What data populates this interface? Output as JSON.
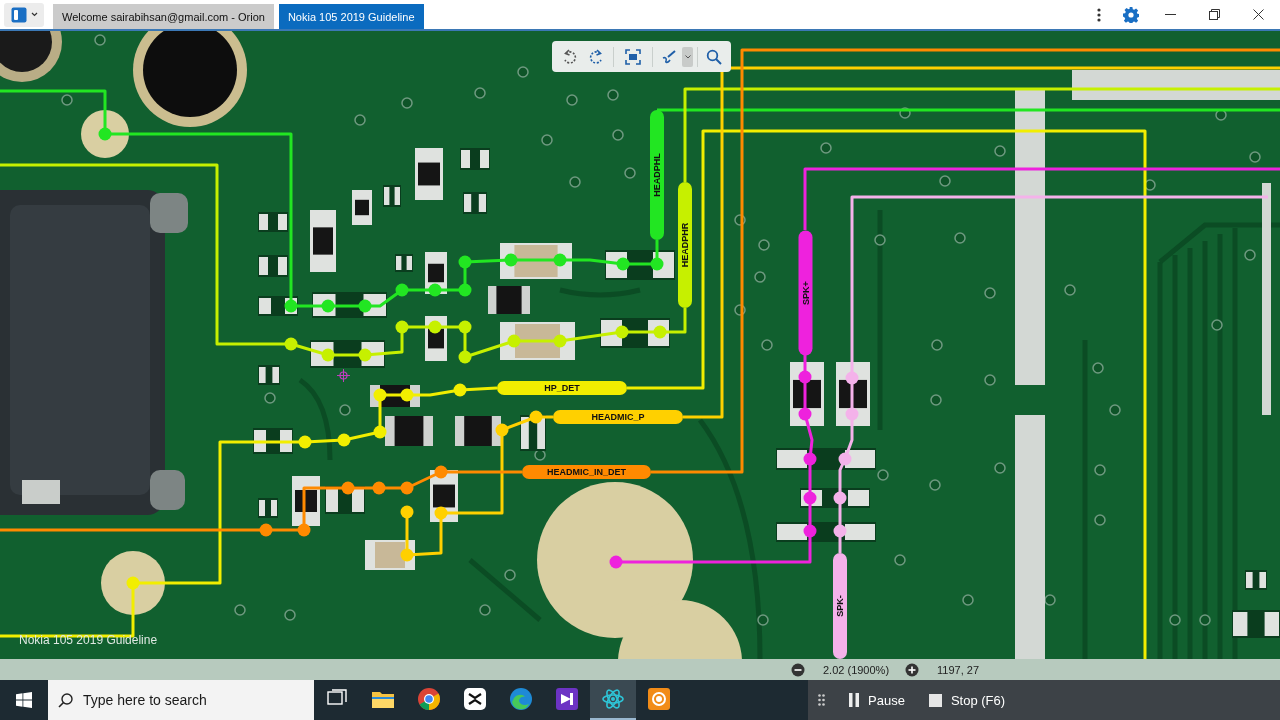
{
  "window": {
    "tabs": [
      {
        "label": "Welcome sairabihsan@gmail.com - Orion",
        "selected": false
      },
      {
        "label": "Nokia 105 2019 Guideline",
        "selected": true
      }
    ]
  },
  "board": {
    "caption": "Nokia 105 2019 Guideline",
    "nets": [
      {
        "label": "HEADPHL",
        "color": "#22e622"
      },
      {
        "label": "HEADPHR",
        "color": "#c6f000"
      },
      {
        "label": "HP_DET",
        "color": "#f2ee00"
      },
      {
        "label": "HEADMIC_P",
        "color": "#ffd000"
      },
      {
        "label": "HEADMIC_IN_DET",
        "color": "#ff8a00"
      },
      {
        "label": "SPK+",
        "color": "#ee22dd"
      },
      {
        "label": "SPK-",
        "color": "#f4b2ea"
      }
    ]
  },
  "status_bar": {
    "zoom": "2.02 (1900%)",
    "coordinates": "1197, 27"
  },
  "taskbar": {
    "search": {
      "placeholder": "Type here to search"
    },
    "apps": [
      {
        "kind": "task-view",
        "selected": false
      },
      {
        "kind": "explorer",
        "selected": false
      },
      {
        "kind": "chrome",
        "selected": false
      },
      {
        "kind": "capcut",
        "selected": false
      },
      {
        "kind": "edge",
        "selected": false
      },
      {
        "kind": "studio",
        "selected": false
      },
      {
        "kind": "orion",
        "selected": true
      },
      {
        "kind": "recorder",
        "selected": false
      }
    ],
    "recorder": {
      "buttons": [
        {
          "kind": "pause",
          "label": "Pause"
        },
        {
          "kind": "stop",
          "label": "Stop (F6)"
        }
      ]
    }
  }
}
